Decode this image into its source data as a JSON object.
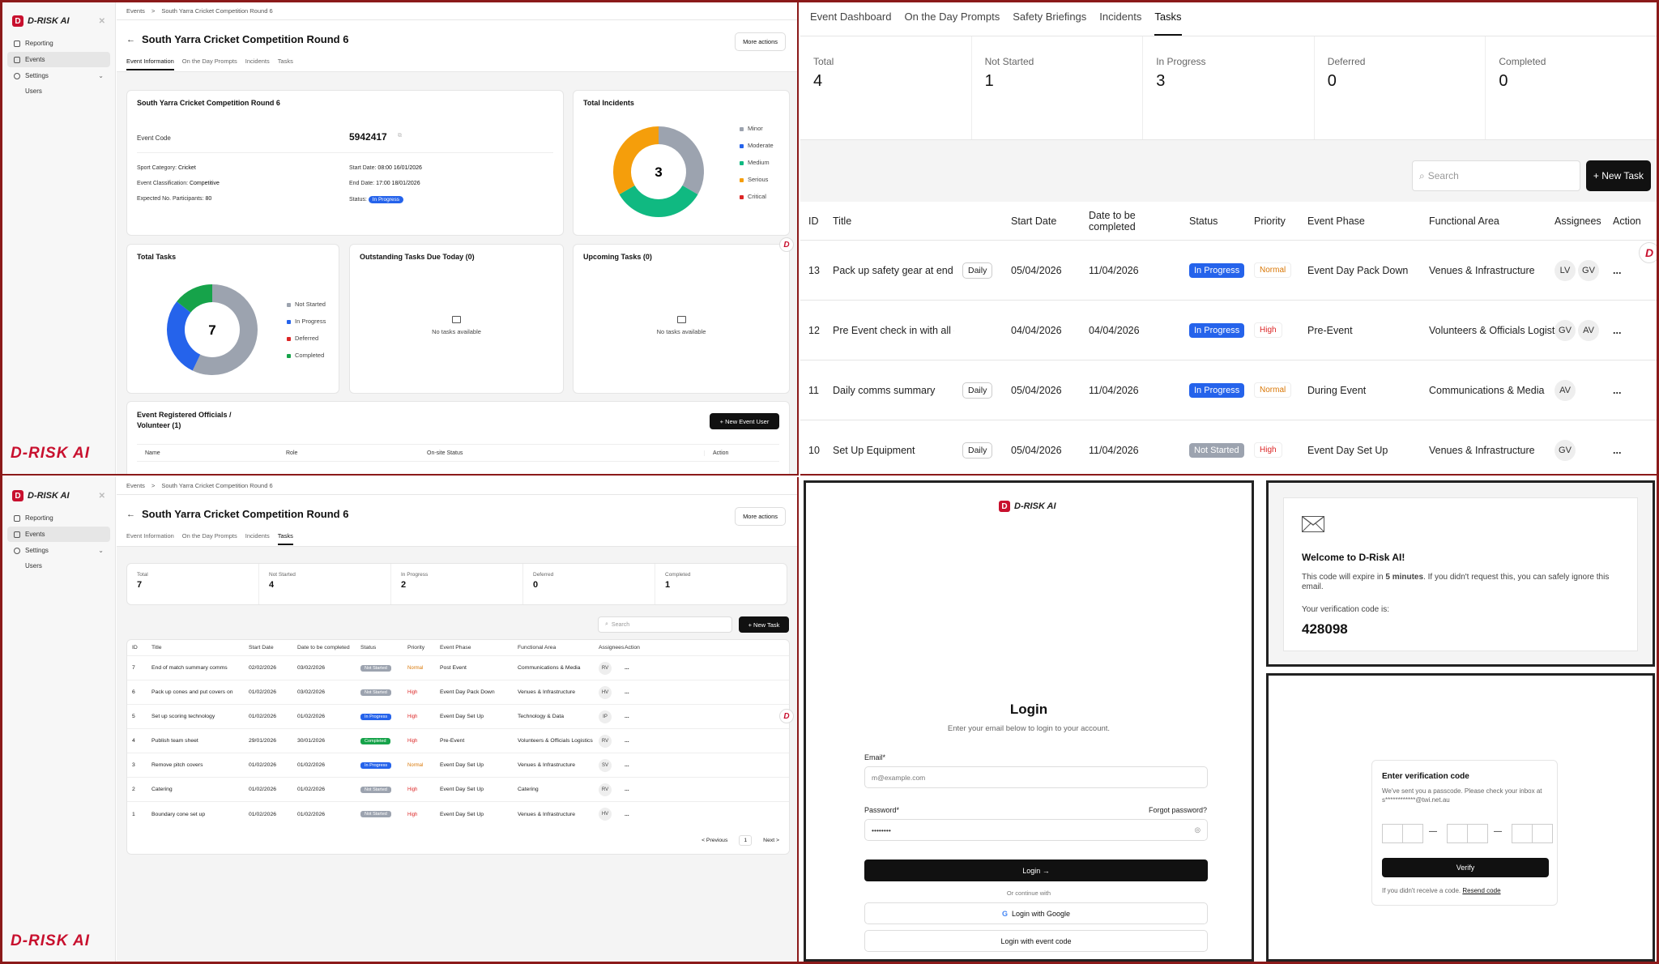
{
  "brand": {
    "logo_text": "D-RISK AI",
    "big_logo": "D-RISK AI",
    "accent": "#c8102e"
  },
  "sidebar": {
    "items": [
      {
        "label": "Reporting"
      },
      {
        "label": "Events"
      },
      {
        "label": "Settings"
      },
      {
        "label": "Users"
      }
    ]
  },
  "breadcrumb": {
    "root": "Events",
    "sep": ">",
    "current": "South Yarra Cricket Competition Round 6"
  },
  "event": {
    "title": "South Yarra Cricket Competition Round 6",
    "back": "←",
    "more_actions": "More actions",
    "tabs": [
      "Event Information",
      "On the Day Prompts",
      "Incidents",
      "Tasks"
    ]
  },
  "event_info": {
    "card_title": "South Yarra Cricket Competition Round 6",
    "code_label": "Event Code",
    "code_value": "5942417",
    "sport_label": "Sport Category:",
    "sport_value": "Cricket",
    "class_label": "Event Classification:",
    "class_value": "Competitive",
    "participants_label": "Expected No. Participants:",
    "participants_value": "80",
    "start_label": "Start Date:",
    "start_value": "08:00 16/01/2026",
    "end_label": "End Date:",
    "end_value": "17:00 18/01/2026",
    "status_label": "Status:",
    "status_value": "In Progress"
  },
  "incidents_card": {
    "title": "Total Incidents",
    "total": "3",
    "legend": [
      "Minor",
      "Moderate",
      "Medium",
      "Serious",
      "Critical"
    ],
    "colors": [
      "#9ca3af",
      "#2563eb",
      "#10b981",
      "#f59e0b",
      "#dc2626"
    ],
    "slices": [
      {
        "name": "Minor",
        "value": 1
      },
      {
        "name": "Medium",
        "value": 1
      },
      {
        "name": "Serious",
        "value": 1
      }
    ]
  },
  "tasks_card": {
    "title": "Total Tasks",
    "total": "7",
    "legend": [
      "Not Started",
      "In Progress",
      "Deferred",
      "Completed"
    ],
    "colors": [
      "#9ca3af",
      "#2563eb",
      "#dc2626",
      "#16a34a"
    ],
    "slices": [
      {
        "name": "Not Started",
        "value": 4
      },
      {
        "name": "In Progress",
        "value": 2
      },
      {
        "name": "Completed",
        "value": 1
      }
    ]
  },
  "outstanding": {
    "title": "Outstanding Tasks Due Today (0)",
    "empty": "No tasks available"
  },
  "upcoming": {
    "title": "Upcoming Tasks (0)",
    "empty": "No tasks available"
  },
  "officials": {
    "title_line1": "Event Registered Officials /",
    "title_line2": "Volunteer (1)",
    "new_user": "+ New Event User",
    "columns": [
      "Name",
      "Role",
      "On-site Status",
      "Action"
    ]
  },
  "tasks_page": {
    "stats": [
      {
        "label": "Total",
        "value": "7"
      },
      {
        "label": "Not Started",
        "value": "4"
      },
      {
        "label": "In Progress",
        "value": "2"
      },
      {
        "label": "Deferred",
        "value": "0"
      },
      {
        "label": "Completed",
        "value": "1"
      }
    ],
    "search_placeholder": "Search",
    "new_task": "+ New Task",
    "columns": [
      "ID",
      "Title",
      "Start Date",
      "Date to be completed",
      "Status",
      "Priority",
      "Event Phase",
      "Functional Area",
      "Assignees",
      "Action"
    ],
    "rows": [
      {
        "id": "7",
        "title": "End of match summary comms",
        "start": "02/02/2026",
        "due": "03/02/2026",
        "status": "Not Started",
        "priority": "Normal",
        "phase": "Post Event",
        "area": "Communications & Media",
        "assignee": "RV",
        "action": "..."
      },
      {
        "id": "6",
        "title": "Pack up cones and put covers on",
        "start": "01/02/2026",
        "due": "03/02/2026",
        "status": "Not Started",
        "priority": "High",
        "phase": "Event Day Pack Down",
        "area": "Venues & Infrastructure",
        "assignee": "HV",
        "action": "..."
      },
      {
        "id": "5",
        "title": "Set up scoring technology",
        "start": "01/02/2026",
        "due": "01/02/2026",
        "status": "In Progress",
        "priority": "High",
        "phase": "Event Day Set Up",
        "area": "Technology & Data",
        "assignee": "IP",
        "action": "..."
      },
      {
        "id": "4",
        "title": "Publish team sheet",
        "start": "29/01/2026",
        "due": "30/01/2026",
        "status": "Completed",
        "priority": "High",
        "phase": "Pre-Event",
        "area": "Volunteers & Officials Logistics",
        "assignee": "RV",
        "action": "..."
      },
      {
        "id": "3",
        "title": "Remove pitch covers",
        "start": "01/02/2026",
        "due": "01/02/2026",
        "status": "In Progress",
        "priority": "Normal",
        "phase": "Event Day Set Up",
        "area": "Venues & Infrastructure",
        "assignee": "SV",
        "action": "..."
      },
      {
        "id": "2",
        "title": "Catering",
        "start": "01/02/2026",
        "due": "01/02/2026",
        "status": "Not Started",
        "priority": "High",
        "phase": "Event Day Set Up",
        "area": "Catering",
        "assignee": "RV",
        "action": "..."
      },
      {
        "id": "1",
        "title": "Boundary cone set up",
        "start": "01/02/2026",
        "due": "01/02/2026",
        "status": "Not Started",
        "priority": "High",
        "phase": "Event Day Set Up",
        "area": "Venues & Infrastructure",
        "assignee": "HV",
        "action": "..."
      }
    ],
    "pagination": {
      "prev": "< Previous",
      "page": "1",
      "next": "Next >"
    }
  },
  "rt": {
    "tabs": [
      "Event Dashboard",
      "On the Day Prompts",
      "Safety Briefings",
      "Incidents",
      "Tasks"
    ],
    "stats": [
      {
        "label": "Total",
        "value": "4"
      },
      {
        "label": "Not Started",
        "value": "1"
      },
      {
        "label": "In Progress",
        "value": "3"
      },
      {
        "label": "Deferred",
        "value": "0"
      },
      {
        "label": "Completed",
        "value": "0"
      }
    ],
    "search_placeholder": "Search",
    "new_task": "+ New Task",
    "columns": [
      "ID",
      "Title",
      "Start Date",
      "Date to be completed",
      "Status",
      "Priority",
      "Event Phase",
      "Functional Area",
      "Assignees",
      "Action"
    ],
    "rows": [
      {
        "id": "13",
        "title": "Pack up safety gear at end of e...",
        "daily": "Daily",
        "start": "05/04/2026",
        "due": "11/04/2026",
        "status": "In Progress",
        "priority": "Normal",
        "phase": "Event Day Pack Down",
        "area": "Venues & Infrastructure",
        "a1": "LV",
        "a2": "GV",
        "action": "..."
      },
      {
        "id": "12",
        "title": "Pre Event check in with all offici...",
        "daily": "",
        "start": "04/04/2026",
        "due": "04/04/2026",
        "status": "In Progress",
        "priority": "High",
        "phase": "Pre-Event",
        "area": "Volunteers & Officials Logistics",
        "a1": "GV",
        "a2": "AV",
        "action": "..."
      },
      {
        "id": "11",
        "title": "Daily comms summary",
        "daily": "Daily",
        "start": "05/04/2026",
        "due": "11/04/2026",
        "status": "In Progress",
        "priority": "Normal",
        "phase": "During Event",
        "area": "Communications & Media",
        "a1": "AV",
        "a2": "",
        "action": "..."
      },
      {
        "id": "10",
        "title": "Set Up Equipment",
        "daily": "Daily",
        "start": "05/04/2026",
        "due": "11/04/2026",
        "status": "Not Started",
        "priority": "High",
        "phase": "Event Day Set Up",
        "area": "Venues & Infrastructure",
        "a1": "GV",
        "a2": "",
        "action": "..."
      }
    ]
  },
  "login": {
    "title": "Login",
    "subtitle": "Enter your email below to login to your account.",
    "email_label": "Email*",
    "email_placeholder": "m@example.com",
    "password_label": "Password*",
    "forgot": "Forgot password?",
    "password_value": "••••••••",
    "login_btn": "Login →",
    "divider": "Or continue with",
    "google_btn": "Login with Google",
    "code_btn": "Login with event code"
  },
  "email": {
    "welcome": "Welcome to D-Risk AI!",
    "expire_pre": "This code will expire in ",
    "expire_bold": "5 minutes",
    "expire_post": ". If you didn't request this, you can safely ignore this email.",
    "code_label": "Your verification code is:",
    "code": "428098"
  },
  "verify": {
    "title": "Enter verification code",
    "desc": "We've sent you a passcode. Please check your inbox at s************@twi.net.au",
    "dash": "—",
    "btn": "Verify",
    "resend_pre": "If you didn't receive a code. ",
    "resend_link": "Resend code"
  }
}
